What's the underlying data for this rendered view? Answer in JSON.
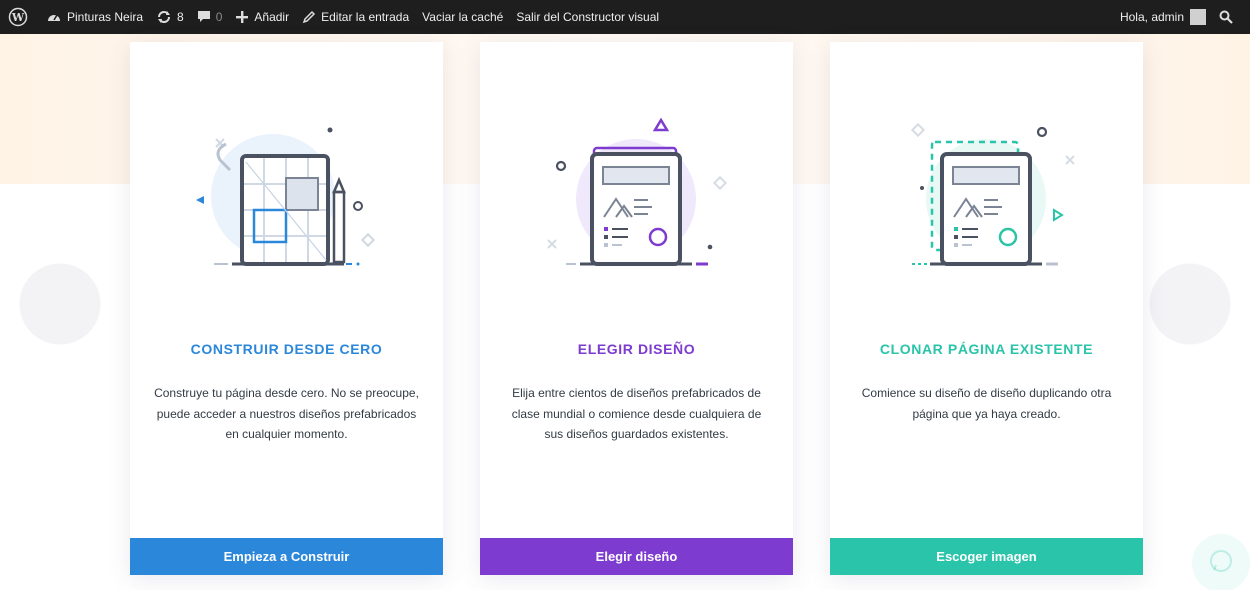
{
  "adminbar": {
    "site_name": "Pinturas Neira",
    "updates_count": "8",
    "comments_count": "0",
    "add_label": "Añadir",
    "edit_label": "Editar la entrada",
    "clear_cache_label": "Vaciar la caché",
    "exit_builder_label": "Salir del Constructor visual",
    "greeting": "Hola, admin"
  },
  "cards": [
    {
      "title": "CONSTRUIR DESDE CERO",
      "description": "Construye tu página desde cero. No se preocupe, puede acceder a nuestros diseños prefabricados en cualquier momento.",
      "button": "Empieza a Construir",
      "accent": "#2b87da"
    },
    {
      "title": "ELEGIR DISEÑO",
      "description": "Elija entre cientos de diseños prefabricados de clase mundial o comience desde cualquiera de sus diseños guardados existentes.",
      "button": "Elegir diseño",
      "accent": "#7e3bd0"
    },
    {
      "title": "CLONAR PÁGINA EXISTENTE",
      "description": "Comience su diseño de diseño duplicando otra página que ya haya creado.",
      "button": "Escoger imagen",
      "accent": "#29c4a9"
    }
  ],
  "colors": {
    "adminbar_bg": "#1e1e1e",
    "text": "#333b45"
  },
  "icons": [
    "wordpress-icon",
    "dashboard-icon",
    "updates-icon",
    "comment-icon",
    "plus-icon",
    "pencil-icon",
    "search-icon",
    "chat-icon"
  ]
}
